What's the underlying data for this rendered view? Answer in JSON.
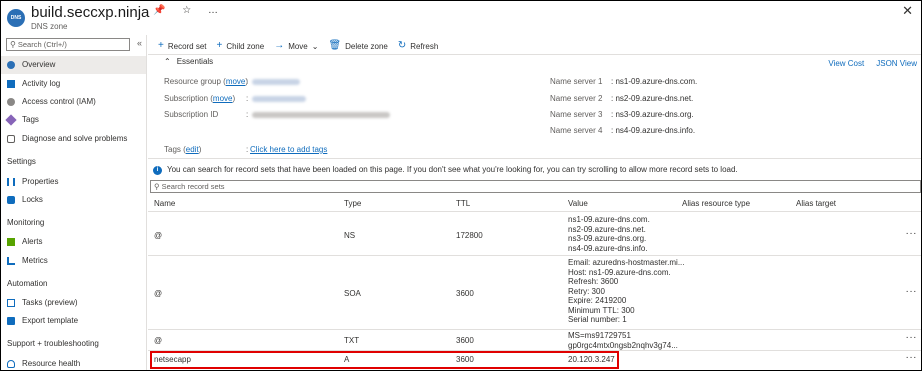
{
  "header": {
    "icon_text": "DNS",
    "title": "build.seccxp.ninja",
    "subtitle": "DNS zone",
    "close": "✕",
    "pin": "📌 ☆ …"
  },
  "sidebar": {
    "search_placeholder": "Search (Ctrl+/)",
    "collapse": "«",
    "items": [
      {
        "label": "Overview",
        "icon": "dns-icon",
        "color": "#2b6fb5"
      },
      {
        "label": "Activity log",
        "icon": "activity-log-icon",
        "color": "#0f6cbd"
      },
      {
        "label": "Access control (IAM)",
        "icon": "iam-icon",
        "color": "#605e5c"
      },
      {
        "label": "Tags",
        "icon": "tag-icon",
        "color": "#8764b8"
      },
      {
        "label": "Diagnose and solve problems",
        "icon": "wrench-icon",
        "color": "#605e5c"
      }
    ],
    "sections": [
      {
        "title": "Settings",
        "items": [
          {
            "label": "Properties",
            "icon": "properties-icon",
            "color": "#0f6cbd"
          },
          {
            "label": "Locks",
            "icon": "lock-icon",
            "color": "#0f6cbd"
          }
        ]
      },
      {
        "title": "Monitoring",
        "items": [
          {
            "label": "Alerts",
            "icon": "alerts-icon",
            "color": "#57a300"
          },
          {
            "label": "Metrics",
            "icon": "metrics-icon",
            "color": "#0f6cbd"
          }
        ]
      },
      {
        "title": "Automation",
        "items": [
          {
            "label": "Tasks (preview)",
            "icon": "tasks-icon",
            "color": "#0f6cbd"
          },
          {
            "label": "Export template",
            "icon": "export-template-icon",
            "color": "#0f6cbd"
          }
        ]
      },
      {
        "title": "Support + troubleshooting",
        "items": [
          {
            "label": "Resource health",
            "icon": "heart-icon",
            "color": "#0f6cbd"
          }
        ]
      }
    ]
  },
  "toolbar": {
    "record_set": "Record set",
    "child_zone": "Child zone",
    "move": "Move",
    "delete_zone": "Delete zone",
    "refresh": "Refresh"
  },
  "essentials": {
    "title": "Essentials",
    "view_cost": "View Cost",
    "json_view": "JSON View",
    "resource_group_label": "Resource group",
    "subscription_label": "Subscription",
    "subscription_id_label": "Subscription ID",
    "tags_label": "Tags",
    "move_link": "move",
    "edit_link": "edit",
    "add_tags": "Click here to add tags",
    "name_servers": [
      {
        "label": "Name server 1",
        "value": "ns1-09.azure-dns.com."
      },
      {
        "label": "Name server 2",
        "value": "ns2-09.azure-dns.net."
      },
      {
        "label": "Name server 3",
        "value": "ns3-09.azure-dns.org."
      },
      {
        "label": "Name server 4",
        "value": "ns4-09.azure-dns.info."
      }
    ]
  },
  "info": "You can search for record sets that have been loaded on this page. If you don't see what you're looking for, you can try scrolling to allow more record sets to load.",
  "record_search_placeholder": "Search record sets",
  "table": {
    "columns": [
      "Name",
      "Type",
      "TTL",
      "Value",
      "Alias resource type",
      "Alias target"
    ],
    "rows": [
      {
        "name": "@",
        "type": "NS",
        "ttl": "172800",
        "value": [
          "ns1-09.azure-dns.com.",
          "ns2-09.azure-dns.net.",
          "ns3-09.azure-dns.org.",
          "ns4-09.azure-dns.info."
        ]
      },
      {
        "name": "@",
        "type": "SOA",
        "ttl": "3600",
        "value": [
          "Email: azuredns-hostmaster.mi...",
          "Host: ns1-09.azure-dns.com.",
          "Refresh: 3600",
          "Retry: 300",
          "Expire: 2419200",
          "Minimum TTL: 300",
          "Serial number: 1"
        ]
      },
      {
        "name": "@",
        "type": "TXT",
        "ttl": "3600",
        "value": [
          "MS=ms91729751",
          "gp0rgc4mtx0ngsb2nqhv3g74..."
        ]
      },
      {
        "name": "netsecapp",
        "type": "A",
        "ttl": "3600",
        "value": [
          "20.120.3.247"
        ]
      }
    ],
    "more": "···"
  }
}
